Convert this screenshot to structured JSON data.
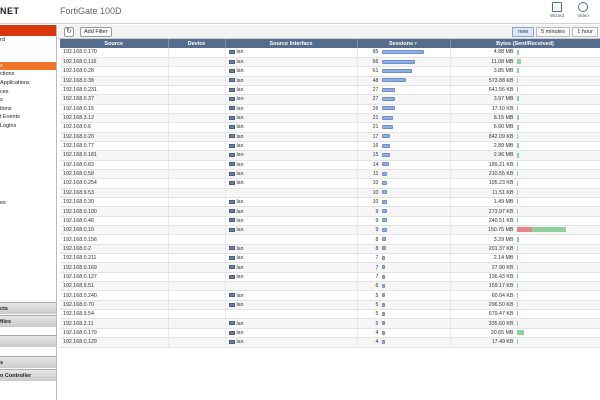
{
  "header": {
    "brand": "NET",
    "device_title": "FortiGate 100D",
    "wizard_label": "Wizard",
    "video_label": "Video"
  },
  "sidebar": {
    "items": [
      {
        "label": "rd",
        "active": false
      },
      {
        "label": "",
        "active": false
      },
      {
        "label": "",
        "active": false
      },
      {
        "label": "s",
        "active": true
      },
      {
        "label": "ctions",
        "active": false
      },
      {
        "label": "Applications",
        "active": false
      },
      {
        "label": "ces",
        "active": false
      },
      {
        "label": "s",
        "active": false
      },
      {
        "label": "tions",
        "active": false
      },
      {
        "label": "t Events",
        "active": false
      },
      {
        "label": "Logins",
        "active": false
      },
      {
        "label": "",
        "active": false
      },
      {
        "label": "",
        "active": false
      },
      {
        "label": "",
        "active": false
      },
      {
        "label": "",
        "active": false
      },
      {
        "label": "",
        "active": false
      },
      {
        "label": "",
        "active": false
      },
      {
        "label": "",
        "active": false
      },
      {
        "label": "",
        "active": false
      },
      {
        "label": "es",
        "active": false
      },
      {
        "label": "",
        "active": false
      }
    ],
    "sections": [
      "cts",
      "files",
      "",
      "s",
      "n Controller"
    ]
  },
  "toolbar": {
    "add_filter_label": "Add Filter",
    "time_ranges": [
      "now",
      "5 minutes",
      "1 hour"
    ],
    "selected_time_range": "now"
  },
  "table": {
    "columns": [
      "Source",
      "Device",
      "Source Interface",
      "Sessions",
      "Bytes (Sent/Received)"
    ],
    "rows": [
      {
        "source": "192.168.0.170",
        "iface": "lan",
        "sessions": "85",
        "bytes": "4.88 MB",
        "sess_frac": 1.0,
        "tx": 0.02,
        "rx": 0
      },
      {
        "source": "192.168.0.116",
        "iface": "lan",
        "sessions": "66",
        "bytes": "11.08 MB",
        "sess_frac": 0.78,
        "tx": 0.05,
        "rx": 0
      },
      {
        "source": "192.168.0.28",
        "iface": "lan",
        "sessions": "61",
        "bytes": "3.85 MB",
        "sess_frac": 0.72,
        "tx": 0.02,
        "rx": 0
      },
      {
        "source": "192.168.0.38",
        "iface": "lan",
        "sessions": "48",
        "bytes": "573.88 KB",
        "sess_frac": 0.56,
        "tx": 0.01,
        "rx": 0
      },
      {
        "source": "192.168.0.231",
        "iface": "lan",
        "sessions": "27",
        "bytes": "641.56 KB",
        "sess_frac": 0.32,
        "tx": 0.01,
        "rx": 0
      },
      {
        "source": "192.168.0.37",
        "iface": "lan",
        "sessions": "27",
        "bytes": "3.97 MB",
        "sess_frac": 0.32,
        "tx": 0.02,
        "rx": 0
      },
      {
        "source": "192.168.0.15",
        "iface": "lan",
        "sessions": "26",
        "bytes": "17.10 KB",
        "sess_frac": 0.31,
        "tx": 0.01,
        "rx": 0
      },
      {
        "source": "192.168.3.12",
        "iface": "lan",
        "sessions": "21",
        "bytes": "8.15 MB",
        "sess_frac": 0.25,
        "tx": 0.03,
        "rx": 0
      },
      {
        "source": "192.168.0.6",
        "iface": "lan",
        "sessions": "21",
        "bytes": "6.90 MB",
        "sess_frac": 0.25,
        "tx": 0.03,
        "rx": 0
      },
      {
        "source": "192.168.0.20",
        "iface": "lan",
        "sessions": "17",
        "bytes": "842.09 KB",
        "sess_frac": 0.2,
        "tx": 0.01,
        "rx": 0
      },
      {
        "source": "192.168.0.77",
        "iface": "lan",
        "sessions": "16",
        "bytes": "2.89 MB",
        "sess_frac": 0.19,
        "tx": 0.02,
        "rx": 0
      },
      {
        "source": "192.168.0.181",
        "iface": "lan",
        "sessions": "15",
        "bytes": "2.96 MB",
        "sess_frac": 0.18,
        "tx": 0.02,
        "rx": 0
      },
      {
        "source": "192.168.0.83",
        "iface": "lan",
        "sessions": "14",
        "bytes": "189.21 KB",
        "sess_frac": 0.16,
        "tx": 0.01,
        "rx": 0
      },
      {
        "source": "192.168.0.58",
        "iface": "lan",
        "sessions": "11",
        "bytes": "210.55 KB",
        "sess_frac": 0.13,
        "tx": 0.01,
        "rx": 0
      },
      {
        "source": "192.168.0.254",
        "iface": "lan",
        "sessions": "10",
        "bytes": "195.23 KB",
        "sess_frac": 0.12,
        "tx": 0.01,
        "rx": 0
      },
      {
        "source": "192.168.9.53",
        "iface": "",
        "sessions": "10",
        "bytes": "11.51 KB",
        "sess_frac": 0.12,
        "tx": 0.01,
        "rx": 0
      },
      {
        "source": "192.168.0.30",
        "iface": "lan",
        "sessions": "10",
        "bytes": "1.49 MB",
        "sess_frac": 0.12,
        "tx": 0.01,
        "rx": 0
      },
      {
        "source": "192.168.0.100",
        "iface": "lan",
        "sessions": "9",
        "bytes": "273.97 KB",
        "sess_frac": 0.11,
        "tx": 0.01,
        "rx": 0
      },
      {
        "source": "192.168.0.46",
        "iface": "lan",
        "sessions": "9",
        "bytes": "240.51 KB",
        "sess_frac": 0.11,
        "tx": 0.01,
        "rx": 0
      },
      {
        "source": "192.168.0.10",
        "iface": "lan",
        "sessions": "9",
        "bytes": "150.75 MB",
        "sess_frac": 0.11,
        "tx": 0.45,
        "rx": 0.2
      },
      {
        "source": "192.168.0.156",
        "iface": "",
        "sessions": "8",
        "bytes": "3.29 MB",
        "sess_frac": 0.09,
        "tx": 0.02,
        "rx": 0
      },
      {
        "source": "192.168.0.2",
        "iface": "lan",
        "sessions": "8",
        "bytes": "201.37 KB",
        "sess_frac": 0.09,
        "tx": 0.01,
        "rx": 0
      },
      {
        "source": "192.168.0.211",
        "iface": "lan",
        "sessions": "7",
        "bytes": "2.14 MB",
        "sess_frac": 0.08,
        "tx": 0.01,
        "rx": 0
      },
      {
        "source": "192.168.0.169",
        "iface": "lan",
        "sessions": "7",
        "bytes": "27.90 KB",
        "sess_frac": 0.08,
        "tx": 0.01,
        "rx": 0
      },
      {
        "source": "192.168.0.127",
        "iface": "lan",
        "sessions": "7",
        "bytes": "136.43 KB",
        "sess_frac": 0.08,
        "tx": 0.01,
        "rx": 0
      },
      {
        "source": "192.168.9.51",
        "iface": "",
        "sessions": "6",
        "bytes": "159.17 KB",
        "sess_frac": 0.07,
        "tx": 0.01,
        "rx": 0
      },
      {
        "source": "192.168.0.240",
        "iface": "lan",
        "sessions": "5",
        "bytes": "60.04 KB",
        "sess_frac": 0.06,
        "tx": 0.01,
        "rx": 0
      },
      {
        "source": "192.168.0.70",
        "iface": "lan",
        "sessions": "5",
        "bytes": "296.50 KB",
        "sess_frac": 0.06,
        "tx": 0.01,
        "rx": 0
      },
      {
        "source": "192.168.9.54",
        "iface": "",
        "sessions": "5",
        "bytes": "679.47 KB",
        "sess_frac": 0.06,
        "tx": 0.01,
        "rx": 0
      },
      {
        "source": "192.168.2.11",
        "iface": "lan",
        "sessions": "5",
        "bytes": "335.60 KB",
        "sess_frac": 0.06,
        "tx": 0.01,
        "rx": 0
      },
      {
        "source": "192.168.0.179",
        "iface": "lan",
        "sessions": "4",
        "bytes": "20.65 MB",
        "sess_frac": 0.05,
        "tx": 0.09,
        "rx": 0
      },
      {
        "source": "192.168.0.129",
        "iface": "lan",
        "sessions": "4",
        "bytes": "17.49 KB",
        "sess_frac": 0.05,
        "tx": 0.01,
        "rx": 0
      }
    ]
  },
  "colors": {
    "header_bar": "#566c8d",
    "sidebar_accent": "#d9350a",
    "sidebar_active": "#f0742b",
    "sessions_bar": "#8fb0e6",
    "bytes_sent": "#8fd19a",
    "bytes_received": "#e5848c"
  }
}
